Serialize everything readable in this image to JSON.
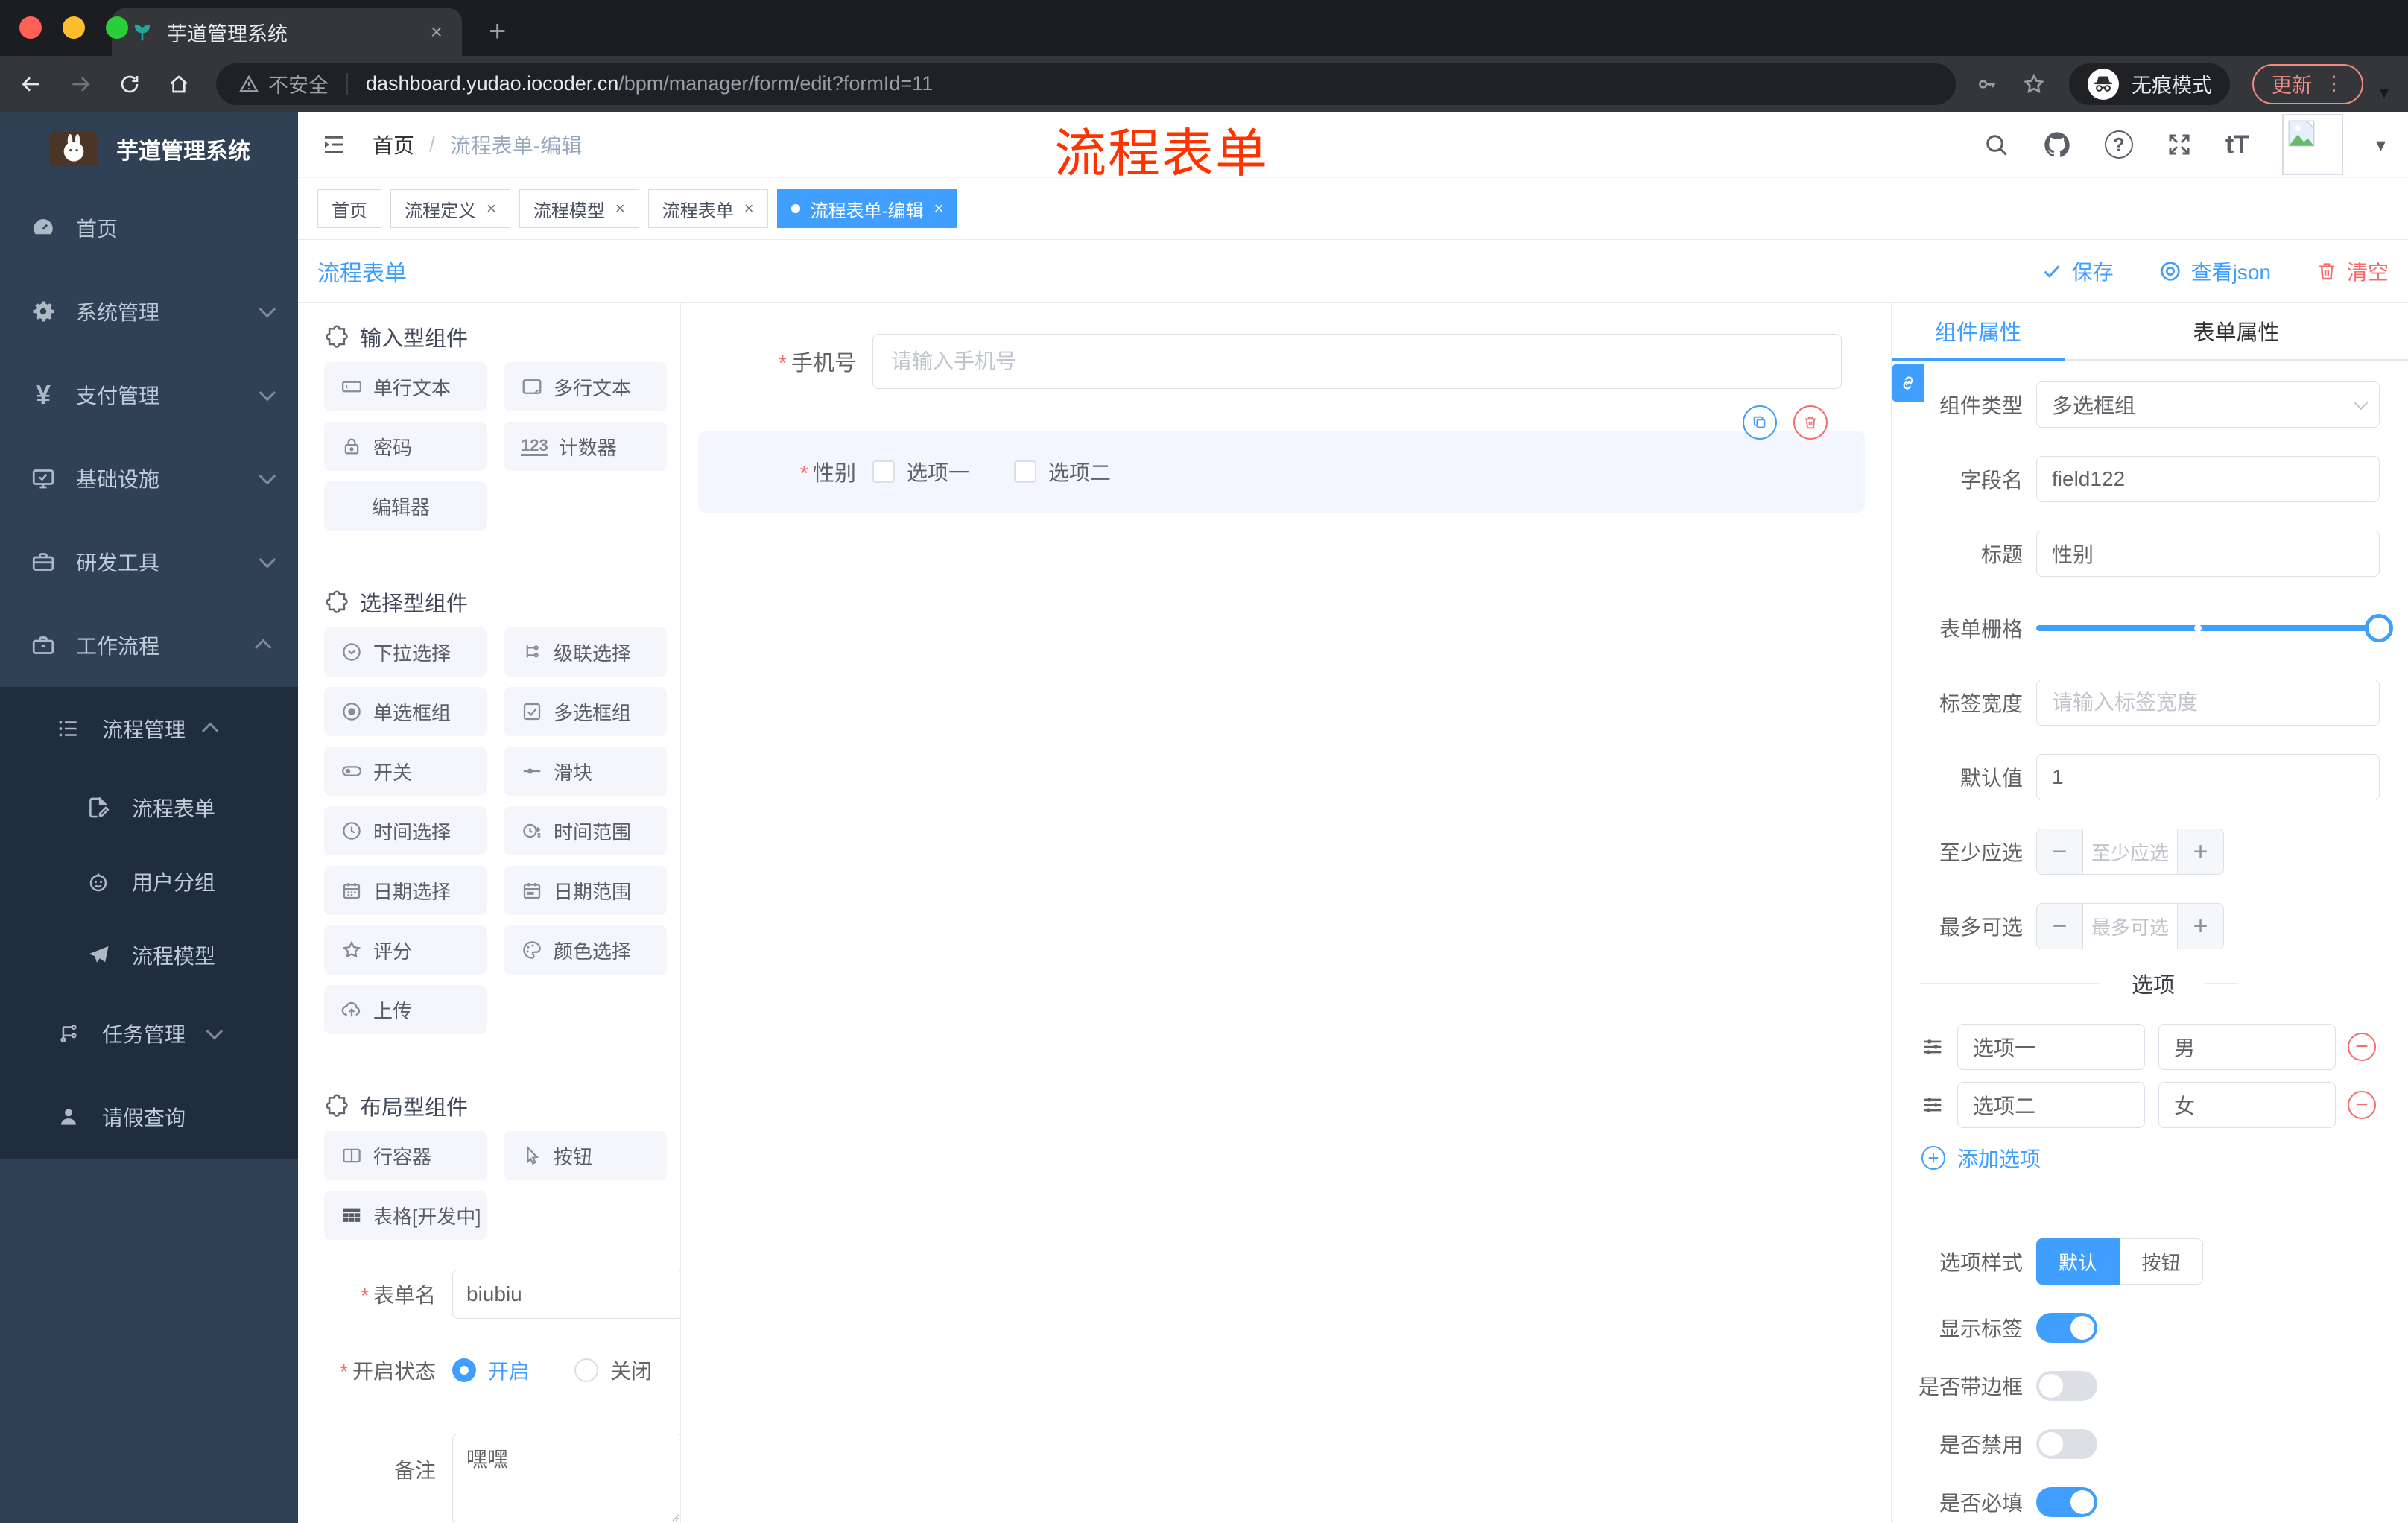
{
  "colors": {
    "accent": "#409eff",
    "danger": "#f56c6c",
    "annotation_red": "#ff3300",
    "sidebar_bg": "#304156",
    "submenu_bg": "#1f2d3d"
  },
  "glyphs": {
    "close": "×",
    "add_tab": "+",
    "more": "⋮",
    "caret_down": "▾",
    "minus": "−",
    "plus": "+",
    "slash": "/",
    "asterisk": "*",
    "question": "?",
    "font_size": "tT",
    "counter": "123",
    "yen": "¥"
  },
  "browser": {
    "tab_title": "芋道管理系统",
    "security_label": "不安全",
    "url_host": "dashboard.yudao.iocoder.cn",
    "url_path": "/bpm/manager/form/edit?formId=11",
    "incognito_label": "无痕模式",
    "update_label": "更新"
  },
  "sidebar": {
    "app_title": "芋道管理系统",
    "items": [
      {
        "label": "首页"
      },
      {
        "label": "系统管理"
      },
      {
        "label": "支付管理"
      },
      {
        "label": "基础设施"
      },
      {
        "label": "研发工具"
      },
      {
        "label": "工作流程"
      }
    ],
    "submenu": {
      "parent": "流程管理",
      "children": [
        {
          "label": "流程表单"
        },
        {
          "label": "用户分组"
        },
        {
          "label": "流程模型"
        }
      ],
      "siblings": [
        {
          "label": "任务管理"
        },
        {
          "label": "请假查询"
        }
      ]
    }
  },
  "header": {
    "breadcrumb_root": "首页",
    "breadcrumb_current": "流程表单-编辑",
    "annotation": "流程表单"
  },
  "tags": [
    {
      "label": "首页"
    },
    {
      "label": "流程定义"
    },
    {
      "label": "流程模型"
    },
    {
      "label": "流程表单"
    },
    {
      "label": "流程表单-编辑"
    }
  ],
  "toolbar": {
    "title": "流程表单",
    "save_label": "保存",
    "view_json_label": "查看json",
    "clear_label": "清空"
  },
  "builder": {
    "sections": [
      {
        "title": "输入型组件",
        "items": [
          {
            "label": "单行文本"
          },
          {
            "label": "多行文本"
          },
          {
            "label": "密码"
          },
          {
            "label": "计数器"
          },
          {
            "label": "编辑器"
          }
        ]
      },
      {
        "title": "选择型组件",
        "items": [
          {
            "label": "下拉选择"
          },
          {
            "label": "级联选择"
          },
          {
            "label": "单选框组"
          },
          {
            "label": "多选框组"
          },
          {
            "label": "开关"
          },
          {
            "label": "滑块"
          },
          {
            "label": "时间选择"
          },
          {
            "label": "时间范围"
          },
          {
            "label": "日期选择"
          },
          {
            "label": "日期范围"
          },
          {
            "label": "评分"
          },
          {
            "label": "颜色选择"
          },
          {
            "label": "上传"
          }
        ]
      },
      {
        "title": "布局型组件",
        "items": [
          {
            "label": "行容器"
          },
          {
            "label": "按钮"
          },
          {
            "label": "表格[开发中]"
          }
        ]
      }
    ],
    "meta": {
      "form_name_label": "表单名",
      "form_name_value": "biubiu",
      "status_label": "开启状态",
      "status_on": "开启",
      "status_off": "关闭",
      "remark_label": "备注",
      "remark_value": "嘿嘿"
    }
  },
  "canvas": {
    "phone_label": "手机号",
    "phone_placeholder": "请输入手机号",
    "gender_label": "性别",
    "gender_options": [
      {
        "label": "选项一"
      },
      {
        "label": "选项二"
      }
    ]
  },
  "inspector": {
    "tab_component": "组件属性",
    "tab_form": "表单属性",
    "type_label": "组件类型",
    "type_value": "多选框组",
    "field_label": "字段名",
    "field_value": "field122",
    "title_label": "标题",
    "title_value": "性别",
    "grid_label": "表单栅格",
    "label_width_label": "标签宽度",
    "label_width_placeholder": "请输入标签宽度",
    "default_label": "默认值",
    "default_value": "1",
    "min_label": "至少应选",
    "min_placeholder": "至少应选",
    "max_label": "最多可选",
    "max_placeholder": "最多可选",
    "options_title": "选项",
    "options": [
      {
        "label": "选项一",
        "value": "男"
      },
      {
        "label": "选项二",
        "value": "女"
      }
    ],
    "add_option_label": "添加选项",
    "style_label": "选项样式",
    "style_default": "默认",
    "style_button": "按钮",
    "show_label_label": "显示标签",
    "border_label": "是否带边框",
    "disabled_label": "是否禁用",
    "required_label": "是否必填"
  }
}
